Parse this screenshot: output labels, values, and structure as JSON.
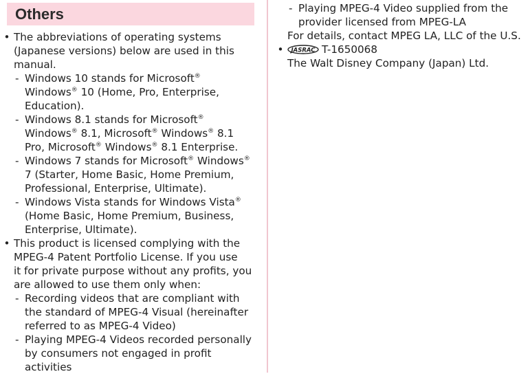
{
  "section": {
    "title": "Others"
  },
  "left_col": {
    "l01": "The abbreviations of operating systems",
    "l02": "(Japanese versions) below are used in this",
    "l03": "manual.",
    "l04": "Windows 10 stands for Microsoft",
    "l05a": "Windows",
    "l05b": " 10 (Home, Pro, Enterprise,",
    "l06": "Education).",
    "l07": "Windows 8.1 stands for Microsoft",
    "l08a": "Windows",
    "l08b": " 8.1, Microsoft",
    "l08c": " Windows",
    "l08d": " 8.1",
    "l09a": "Pro, Microsoft",
    "l09b": " Windows",
    "l09c": " 8.1 Enterprise.",
    "l10a": "Windows 7 stands for Microsoft",
    "l10b": " Windows",
    "l11": "7 (Starter, Home Basic, Home Premium,",
    "l12": "Professional, Enterprise, Ultimate).",
    "l13": "Windows Vista stands for Windows Vista",
    "l14": "(Home Basic, Home Premium, Business,",
    "l15": "Enterprise, Ultimate).",
    "l16": "This product is licensed complying with the",
    "l17": "MPEG-4 Patent Portfolio License. If you use",
    "l18": "it for private purpose without any profits, you",
    "l19": "are allowed to use them only when:",
    "l20": "Recording videos that are compliant with",
    "l21": "the standard of MPEG-4 Visual (hereinafter",
    "l22": "referred to as MPEG-4 Video)",
    "l23": "Playing MPEG-4 Videos recorded personally",
    "l24": "by consumers not engaged in profit",
    "l25": "activities"
  },
  "right_col": {
    "r01": "Playing MPEG-4 Video supplied from the",
    "r02": "provider licensed from MPEG-LA",
    "r03": "For details, contact MPEG LA, LLC of the U.S.",
    "r04": "T-1650068",
    "r05": "The Walt Disney Company (Japan) Ltd."
  },
  "symbols": {
    "bullet": "•",
    "dash": "-",
    "registered": "®"
  },
  "logo": {
    "text": "JASRAC"
  },
  "colors": {
    "header_bg": "#fbd7df",
    "divider": "#f1c6cf"
  }
}
